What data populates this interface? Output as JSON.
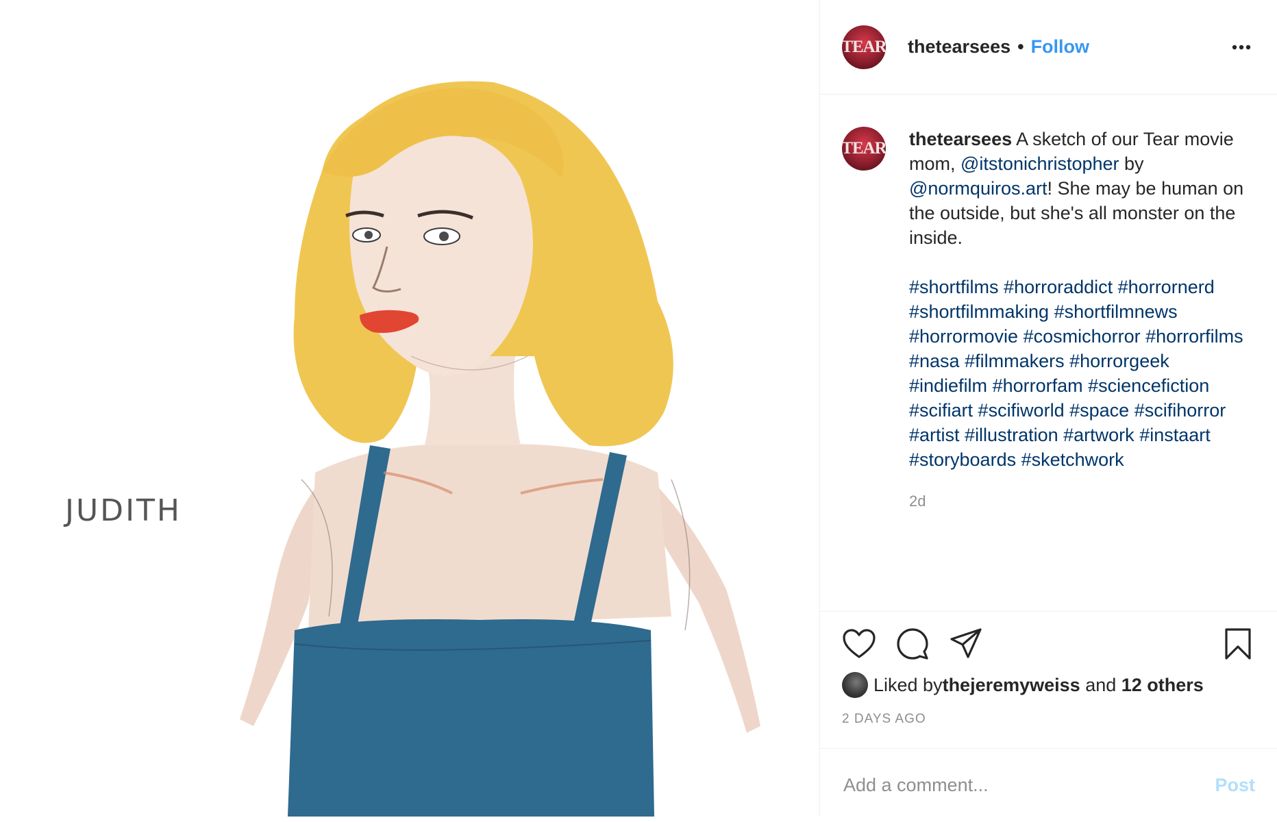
{
  "post": {
    "image_label": "JUDITH",
    "author": {
      "avatar_text": "TEAR",
      "username": "thetearsees",
      "separator": "•",
      "follow_label": "Follow",
      "more_icon": "more-horizontal-icon"
    },
    "caption": {
      "username": "thetearsees",
      "text_1": " A sketch of our Tear movie mom, ",
      "mention_1": "@itstonichristopher",
      "text_2": " by ",
      "mention_2": "@normquiros.art",
      "text_3": "! She may be human on the outside, but she's all monster on the inside.",
      "hashtags": [
        "#shortfilms",
        "#horroraddict",
        "#horrornerd",
        "#shortfilmmaking",
        "#shortfilmnews",
        "#horrormovie",
        "#cosmichorror",
        "#horrorfilms",
        "#nasa",
        "#filmmakers",
        "#horrorgeek",
        "#indiefilm",
        "#horrorfam",
        "#sciencefiction",
        "#scifiart",
        "#scifiworld",
        "#space",
        "#scifihorror",
        "#artist",
        "#illustration",
        "#artwork",
        "#instaart",
        "#storyboards",
        "#sketchwork"
      ],
      "relative_time": "2d"
    },
    "actions": {
      "like_icon": "heart-icon",
      "comment_icon": "comment-icon",
      "share_icon": "share-icon",
      "save_icon": "bookmark-icon"
    },
    "likes": {
      "prefix": "Liked by ",
      "liker": "thejeremyweiss",
      "middle": " and ",
      "others": "12 others"
    },
    "posted_ago": "2 DAYS AGO",
    "comment": {
      "placeholder": "Add a comment...",
      "post_label": "Post"
    }
  }
}
